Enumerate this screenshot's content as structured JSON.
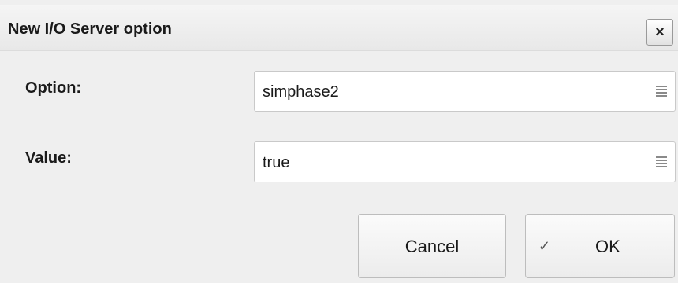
{
  "dialog": {
    "title": "New I/O Server option",
    "close_symbol": "×"
  },
  "fields": {
    "option": {
      "label": "Option:",
      "value": "simphase2",
      "icon": "list-icon"
    },
    "value": {
      "label": "Value:",
      "value": "true",
      "icon": "list-icon"
    }
  },
  "buttons": {
    "cancel_label": "Cancel",
    "ok_label": "OK",
    "ok_check": "✓"
  }
}
